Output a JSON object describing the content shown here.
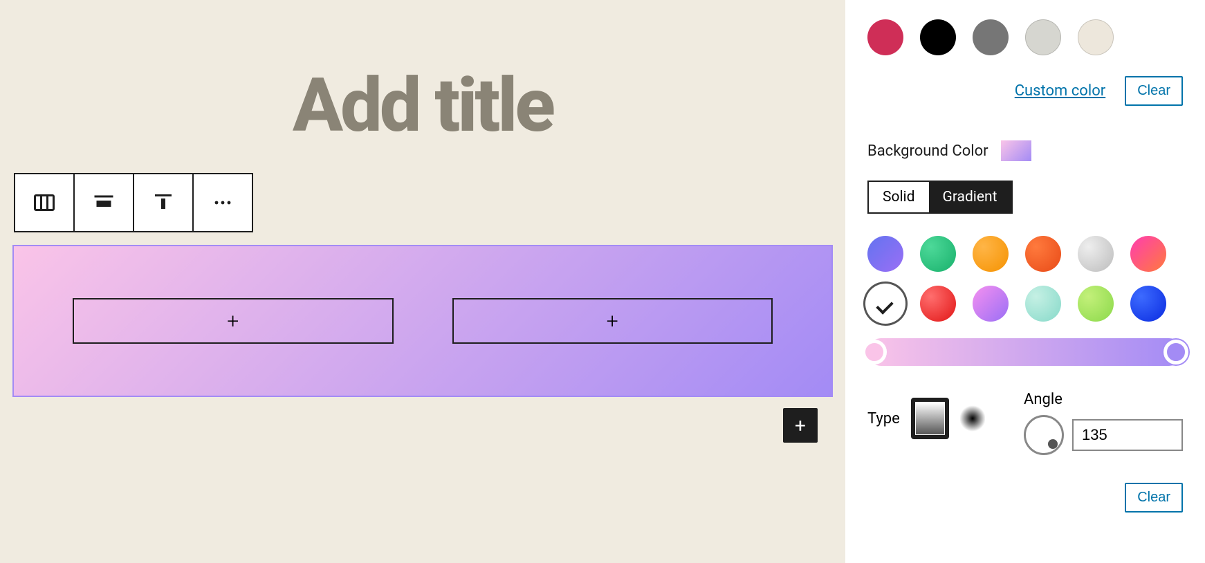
{
  "editor": {
    "title_placeholder": "Add title",
    "add_block_glyph": "+"
  },
  "sidebar": {
    "text_colors": [
      {
        "name": "vivid-red",
        "color": "#cf2e57"
      },
      {
        "name": "black",
        "color": "#000000"
      },
      {
        "name": "gray",
        "color": "#767676"
      },
      {
        "name": "pale-gray",
        "color": "#d6d6d0"
      },
      {
        "name": "off-white",
        "color": "#ede7dc"
      }
    ],
    "custom_color_link": "Custom color",
    "clear_label": "Clear",
    "background_color_label": "Background Color",
    "segments": {
      "solid": "Solid",
      "gradient": "Gradient"
    },
    "gradients_row1": [
      {
        "name": "blue-purple",
        "css": "linear-gradient(135deg,#6373f0,#9a6ff5)"
      },
      {
        "name": "green",
        "css": "radial-gradient(circle at 30% 30%, #4dd999, #18b06b)"
      },
      {
        "name": "orange",
        "css": "radial-gradient(circle at 30% 30%, #ffb547, #f59200)"
      },
      {
        "name": "red-orange",
        "css": "radial-gradient(circle at 30% 30%, #ff7a3d, #e84a17)"
      },
      {
        "name": "silver",
        "css": "radial-gradient(circle at 30% 30%, #eee, #bcbcbc)"
      },
      {
        "name": "magenta-orange",
        "css": "linear-gradient(135deg,#ff3db0,#ff7a3d)"
      }
    ],
    "gradients_row2": [
      {
        "name": "selected-pink-purple",
        "selected": true
      },
      {
        "name": "red",
        "css": "radial-gradient(circle at 30% 30%, #ff6e6e, #e11515)"
      },
      {
        "name": "pink-purple",
        "css": "linear-gradient(135deg,#f590f0,#9a6ff5)"
      },
      {
        "name": "teal",
        "css": "radial-gradient(circle at 30% 30%, #c5f0e4, #86d9c9)"
      },
      {
        "name": "lime",
        "css": "radial-gradient(circle at 30% 30%, #c3f07a, #8bd94a)"
      },
      {
        "name": "blue",
        "css": "radial-gradient(circle at 30% 30%, #3d6bff, #0a2be0)"
      }
    ],
    "gradient_stops": {
      "start": "#fac4e8",
      "end": "#a38bf5"
    },
    "type_label": "Type",
    "angle_label": "Angle",
    "angle_value": "135"
  }
}
